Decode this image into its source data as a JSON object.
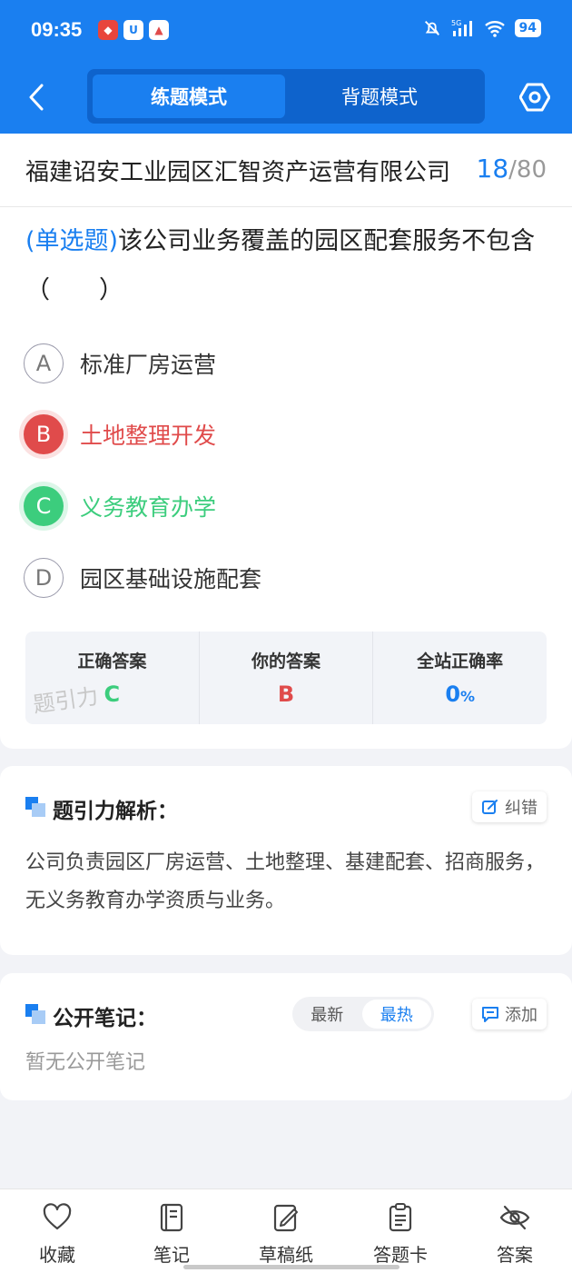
{
  "status_bar": {
    "time": "09:35",
    "battery": "94",
    "network": "5G"
  },
  "nav": {
    "mode_practice": "练题模式",
    "mode_memorize": "背题模式"
  },
  "question": {
    "title": "福建诏安工业园区汇智资产运营有限公司",
    "current": "18",
    "total": "80",
    "type": "(单选题)",
    "text": "该公司业务覆盖的园区配套服务不包含（　　）",
    "options": [
      {
        "letter": "A",
        "text": "标准厂房运营"
      },
      {
        "letter": "B",
        "text": "土地整理开发"
      },
      {
        "letter": "C",
        "text": "义务教育办学"
      },
      {
        "letter": "D",
        "text": "园区基础设施配套"
      }
    ]
  },
  "stats": {
    "correct_label": "正确答案",
    "correct_value": "C",
    "yours_label": "你的答案",
    "yours_value": "B",
    "rate_label": "全站正确率",
    "rate_value": "0",
    "rate_unit": "%",
    "watermark": "题引力"
  },
  "analysis": {
    "title": "题引力解析：",
    "report_label": "纠错",
    "text": "公司负责园区厂房运营、土地整理、基建配套、招商服务，无义务教育办学资质与业务。"
  },
  "notes": {
    "title": "公开笔记：",
    "sort_latest": "最新",
    "sort_hot": "最热",
    "add_label": "添加",
    "empty_text": "暂无公开笔记"
  },
  "bottom_tabs": [
    "收藏",
    "笔记",
    "草稿纸",
    "答题卡",
    "答案"
  ],
  "colors": {
    "primary": "#1a7ff0",
    "wrong": "#e04b4b",
    "right": "#3ccd7d"
  }
}
